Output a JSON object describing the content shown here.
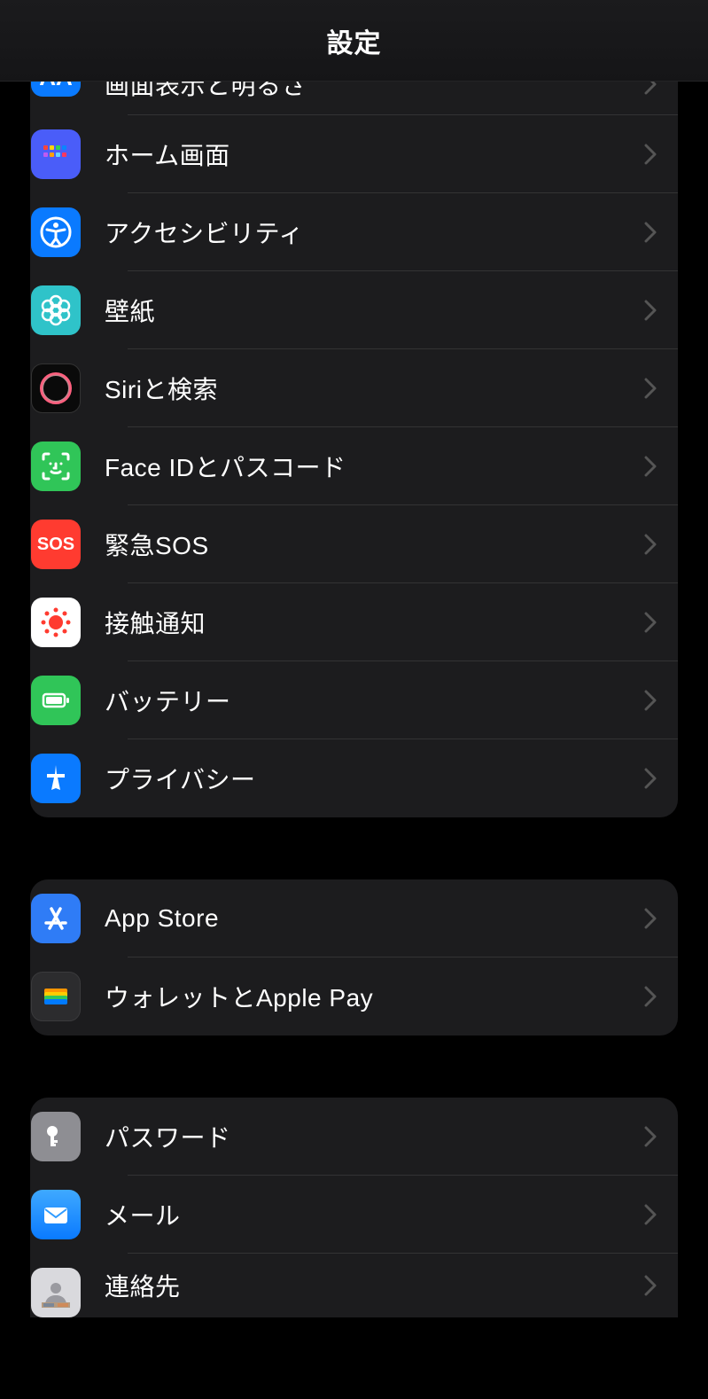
{
  "header": {
    "title": "設定"
  },
  "groups": [
    {
      "items": [
        {
          "id": "display",
          "label": "画面表示と明るさ",
          "icon": "display-brightness-icon"
        },
        {
          "id": "home",
          "label": "ホーム画面",
          "icon": "home-screen-icon"
        },
        {
          "id": "accessibility",
          "label": "アクセシビリティ",
          "icon": "accessibility-icon"
        },
        {
          "id": "wallpaper",
          "label": "壁紙",
          "icon": "wallpaper-icon"
        },
        {
          "id": "siri",
          "label": "Siriと検索",
          "icon": "siri-icon"
        },
        {
          "id": "faceid",
          "label": "Face IDとパスコード",
          "icon": "faceid-icon"
        },
        {
          "id": "sos",
          "label": "緊急SOS",
          "icon": "sos-icon"
        },
        {
          "id": "exposure",
          "label": "接触通知",
          "icon": "exposure-notification-icon"
        },
        {
          "id": "battery",
          "label": "バッテリー",
          "icon": "battery-icon"
        },
        {
          "id": "privacy",
          "label": "プライバシー",
          "icon": "privacy-icon"
        }
      ]
    },
    {
      "items": [
        {
          "id": "appstore",
          "label": "App Store",
          "icon": "app-store-icon"
        },
        {
          "id": "wallet",
          "label": "ウォレットとApple Pay",
          "icon": "wallet-icon"
        }
      ]
    },
    {
      "items": [
        {
          "id": "passwords",
          "label": "パスワード",
          "icon": "passwords-icon"
        },
        {
          "id": "mail",
          "label": "メール",
          "icon": "mail-icon"
        },
        {
          "id": "contacts",
          "label": "連絡先",
          "icon": "contacts-icon"
        }
      ]
    }
  ]
}
